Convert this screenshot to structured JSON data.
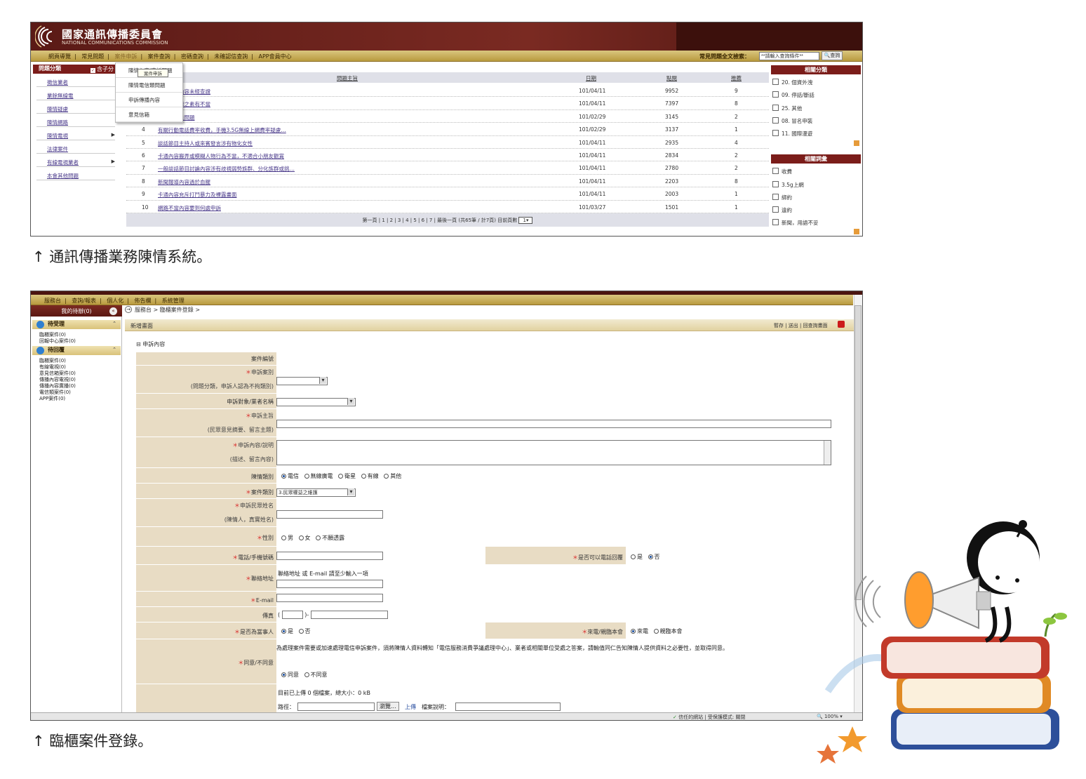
{
  "screen1": {
    "logo_title": "國家通訊傳播委員會",
    "logo_subtitle": "NATIONAL COMMUNICATIONS COMMISSION",
    "nav": [
      "網頁導覽",
      "常見問題",
      "案件申訴",
      "案件查詢",
      "密碼查詢",
      "未確認信查詢",
      "APP會員中心"
    ],
    "search_label": "常見問題全文檢索：",
    "search_placeholder": "**請輸入查詢條件**",
    "search_button": "查詢",
    "category_head": "問題分類",
    "include_sub": "含子分",
    "categories": [
      "徵信業者",
      "業餘無線電",
      "陳情疑慮",
      "陳情網路",
      "陳情電視",
      "法律案件",
      "有線電視業者",
      "本會其他問題"
    ],
    "dropdown": [
      "陳情內容/申訴問題",
      "陳情電信類問題",
      "申訴傳播內容",
      "意見信箱"
    ],
    "tooltip": "案件申訴",
    "table_headers": [
      "問題主旨",
      "日期",
      "點閱",
      "推薦"
    ],
    "rows": [
      {
        "no": "1",
        "title": "…不當、內容未經查證",
        "date": "101/04/11",
        "views": "9952",
        "votes": "9"
      },
      {
        "no": "2",
        "title": "…節目節錄之素有不當",
        "date": "101/04/11",
        "views": "7397",
        "votes": "8"
      },
      {
        "no": "3",
        "title": "…訪談不良問題",
        "date": "101/02/29",
        "views": "3145",
        "votes": "2"
      },
      {
        "no": "4",
        "title": "有關行動電話費率收費，手機3.5G無線上網費率疑慮…",
        "date": "101/02/29",
        "views": "3137",
        "votes": "1"
      },
      {
        "no": "5",
        "title": "談話節目主持人或來賓發言涉有物化女性",
        "date": "101/04/11",
        "views": "2935",
        "votes": "4"
      },
      {
        "no": "6",
        "title": "卡通內容搬弄或模糊人物行為不當，不適合小朋友觀賞",
        "date": "101/04/11",
        "views": "2834",
        "votes": "2"
      },
      {
        "no": "7",
        "title": "一般談話節目討論內容涉有歧視弱勢族群、分化族群或挑…",
        "date": "101/04/11",
        "views": "2780",
        "votes": "2"
      },
      {
        "no": "8",
        "title": "新聞報導內容過於血腥",
        "date": "101/04/11",
        "views": "2203",
        "votes": "8"
      },
      {
        "no": "9",
        "title": "卡通內容充斥打鬥暴力及裸露畫面",
        "date": "101/04/11",
        "views": "2003",
        "votes": "1"
      },
      {
        "no": "10",
        "title": "網路不當內容要到何處申訴",
        "date": "101/03/27",
        "views": "1501",
        "votes": "1"
      }
    ],
    "pager": "第一頁 | 1 | 2 | 3 | 4 | 5 | 6 | 7 | 最後一頁 (共65筆 / 計7頁) 目前頁數",
    "pager_value": "1",
    "related_cat_head": "相關分類",
    "related_cats": [
      "20. 個資外洩",
      "09. 停話/斷話",
      "25. 其他",
      "08. 冒名申裝",
      "11. 國際漫遊"
    ],
    "related_word_head": "相關詞彙",
    "related_words": [
      "收費",
      "3.5g上網",
      "綁約",
      "違約",
      "新聞，用語不妥"
    ]
  },
  "caption1": "↑ 通訊傳播業務陳情系統。",
  "screen2": {
    "nav": [
      "服務台",
      "查詢/報表",
      "個人化",
      "佈告欄",
      "系統管理"
    ],
    "todo_head": "我的待辦(0)",
    "pending_head": "待受理",
    "pending_links": [
      "臨櫃案件(0)",
      "回報中心案件(0)"
    ],
    "processing_head": "待回覆",
    "processing_links": [
      "臨櫃案件(0)",
      "有線電視(0)",
      "意見信箱案件(0)",
      "傳播內容電視(0)",
      "傳播內容廣播(0)",
      "電信類案件(0)",
      "APP案件(0)"
    ],
    "breadcrumb": "服務台 > 臨櫃案件登錄 >",
    "form_title": "新增畫面",
    "toolbar_actions": "暫存 | 送出 | 回查詢畫面",
    "section_title": "申訴內容",
    "fields": {
      "case_no": "案件編號",
      "complaint_type": "申訴案別",
      "complaint_type_note": "(問題分類，申訴人認為不拘類別)",
      "target": "申訴對象/業者名稱",
      "subject": "申訴主旨",
      "subject_note": "(民眾意見摘要、留言主題)",
      "content": "申訴內容/說明",
      "content_note": "(描述、留言內容)",
      "petition_type": "陳情類別",
      "petition_options": [
        "電信",
        "無線廣電",
        "衛星",
        "有線",
        "其他"
      ],
      "case_type": "案件類別",
      "case_type_value": "3.民眾權益之維護",
      "name": "申訴民眾姓名",
      "name_note": "(陳情人，真實姓名)",
      "gender": "性別",
      "gender_options": [
        "男",
        "女",
        "不願透露"
      ],
      "phone": "電話/手機號碼",
      "callback": "是否可以電話回覆",
      "callback_options": [
        "是",
        "否"
      ],
      "address": "聯絡地址",
      "address_hint": "聯絡地址 或 E-mail 請至少輸入一項",
      "email": "E-mail",
      "fax": "傳真",
      "is_party": "是否為當事人",
      "is_party_options": [
        "是",
        "否"
      ],
      "source": "來電/親臨本會",
      "source_options": [
        "來電",
        "親臨本會"
      ],
      "consent": "同意/不同意",
      "consent_text": "為處理案件需要或加速處理電信申訴案件，須將陳情人資料轉知「電信服務消費爭議處理中心」、業者或相關單位受處之答案，請輸值同仁告知陳情人提供資料之必要性，並取得同意。",
      "consent_options": [
        "同意",
        "不同意"
      ],
      "upload_status": "目前已上傳 0 個檔案，總大小：0 kB",
      "path": "路徑：",
      "browse": "瀏覽...",
      "upload": "上傳",
      "file_desc": "檔案說明："
    },
    "status_text": "信任的網站 | 受保護模式: 關閉",
    "zoom": "100%"
  },
  "caption2": "↑ 臨櫃案件登錄。",
  "colors": {
    "brand": "#7b1d1a",
    "nav": "#c9ae58",
    "label_bg": "#e8dcc4"
  }
}
